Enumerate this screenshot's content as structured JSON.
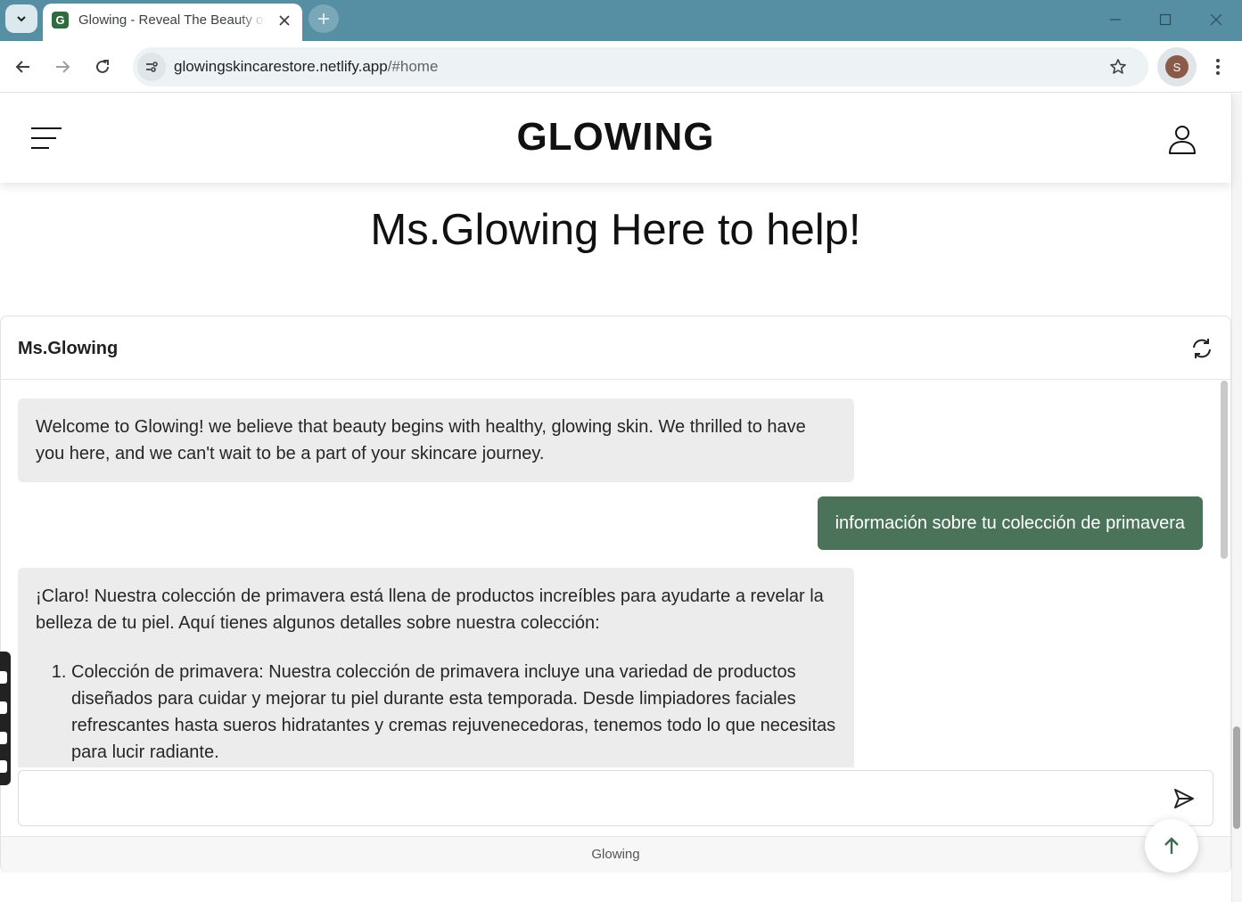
{
  "browser": {
    "tab_title": "Glowing - Reveal The Beauty of Skin",
    "favicon_letter": "G",
    "url_host": "glowingskincarestore.netlify.app",
    "url_path": "/#home",
    "profile_initial": "S"
  },
  "site": {
    "logo": "GLOWING",
    "help_title": "Ms.Glowing Here to help!"
  },
  "chat": {
    "name": "Ms.Glowing",
    "messages": [
      {
        "role": "bot",
        "text": "Welcome to Glowing! we believe that beauty begins with healthy, glowing skin. We thrilled to have you here, and we can't wait to be a part of your skincare journey."
      },
      {
        "role": "user",
        "text": "información sobre tu colección de primavera"
      },
      {
        "role": "bot",
        "text": "¡Claro! Nuestra colección de primavera está llena de productos increíbles para ayudarte a revelar la belleza de tu piel. Aquí tienes algunos detalles sobre nuestra colección:",
        "list": [
          "Colección de primavera: Nuestra colección de primavera incluye una variedad de productos diseñados para cuidar y mejorar tu piel durante esta temporada. Desde limpiadores faciales refrescantes hasta sueros hidratantes y cremas rejuvenecedoras, tenemos todo lo que necesitas para lucir radiante."
        ]
      }
    ],
    "input_value": "",
    "footer": "Glowing"
  },
  "colors": {
    "tabbar": "#568fa3",
    "user_bubble": "#4a735a",
    "bot_bubble": "#ececec"
  },
  "icons": [
    "chevron-down-icon",
    "close-icon",
    "plus-icon",
    "back-arrow-icon",
    "forward-arrow-icon",
    "reload-icon",
    "site-info-icon",
    "star-icon",
    "kebab-icon",
    "hamburger-icon",
    "user-icon",
    "refresh-icon",
    "send-icon",
    "arrow-up-icon"
  ]
}
